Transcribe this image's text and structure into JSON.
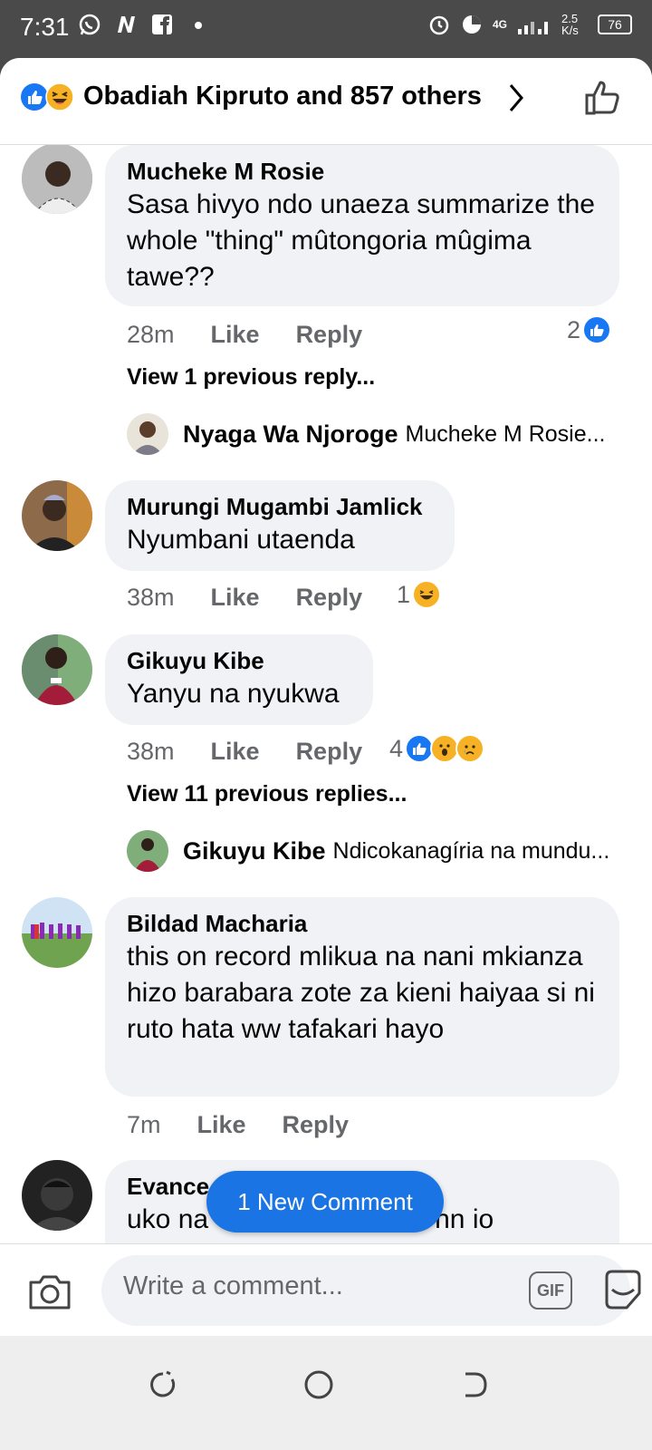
{
  "status_bar": {
    "time": "7:31",
    "network_speed": "2.5 K/s",
    "network_type": "4G",
    "battery": "76",
    "icons": [
      "whatsapp-icon",
      "app-n-icon",
      "facebook-icon",
      "dot-icon",
      "alarm-icon",
      "data-saver-icon",
      "signal-icon",
      "battery-icon"
    ]
  },
  "header": {
    "reactions_summary": "Obadiah Kipruto and 857 others",
    "accent_color": "#1877f2"
  },
  "comments": [
    {
      "author": "Mucheke M Rosie",
      "text": "Sasa hivyo ndo unaeza summarize the whole \"thing\" mûtongoria mûgima tawe??",
      "time": "28m",
      "like_label": "Like",
      "reply_label": "Reply",
      "reaction_count": "2",
      "reactions": [
        "like"
      ],
      "view_previous": "View 1 previous reply...",
      "reply_preview": {
        "author": "Nyaga Wa Njoroge",
        "text": "Mucheke M Rosie..."
      }
    },
    {
      "author": "Murungi Mugambi Jamlick",
      "text": "Nyumbani utaenda",
      "time": "38m",
      "like_label": "Like",
      "reply_label": "Reply",
      "reaction_count": "1",
      "reactions": [
        "haha"
      ]
    },
    {
      "author": "Gikuyu Kibe",
      "text": "Yanyu na nyukwa",
      "time": "38m",
      "like_label": "Like",
      "reply_label": "Reply",
      "reaction_count": "4",
      "reactions": [
        "like",
        "wow",
        "sad"
      ],
      "view_previous": "View 11 previous replies...",
      "reply_preview": {
        "author": "Gikuyu Kibe",
        "text": "Ndicokanagíria na mundu..."
      }
    },
    {
      "author": "Bildad Macharia",
      "text": "this on record mlikua na nani mkianza hizo barabara zote za kieni haiyaa si ni ruto hata ww tafakari hayo",
      "time": "7m",
      "like_label": "Like",
      "reply_label": "Reply"
    },
    {
      "author": "Evance C",
      "text": "uko na                              nn io"
    }
  ],
  "new_comment_button": "1 New Comment",
  "composer": {
    "placeholder": "Write a comment...",
    "gif_label": "GIF"
  }
}
